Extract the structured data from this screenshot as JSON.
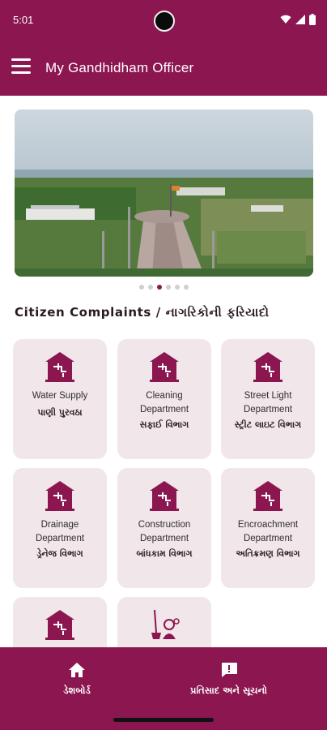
{
  "status_bar": {
    "time": "5:01",
    "icons": [
      "wifi-icon",
      "signal-icon",
      "battery-icon"
    ]
  },
  "app_bar": {
    "title": "My Gandhidham Officer",
    "menu_icon": "hamburger-menu-icon"
  },
  "carousel": {
    "dot_count": 6,
    "active_index": 2
  },
  "section": {
    "title": "Citizen Complaints / નાગરિકોની ફરિયાદો"
  },
  "departments": [
    {
      "en": "Water Supply",
      "gu": "પાણી પુરવઠા",
      "icon": "department-building-icon"
    },
    {
      "en": "Cleaning Department",
      "gu": "સફાઈ વિભાગ",
      "icon": "department-building-icon"
    },
    {
      "en": "Street Light Department",
      "gu": "સ્ટ્રીટ લાઇટ વિભાગ",
      "icon": "department-building-icon"
    },
    {
      "en": "Drainage Department",
      "gu": "ડ્રેનેજ વિભાગ",
      "icon": "department-building-icon"
    },
    {
      "en": "Construction Department",
      "gu": "બાંધકામ વિભાગ",
      "icon": "department-building-icon"
    },
    {
      "en": "Encroachment Department",
      "gu": "અતિક્રમણ વિભાગ",
      "icon": "department-building-icon"
    },
    {
      "en": "",
      "gu": "",
      "icon": "department-building-icon"
    },
    {
      "en": "",
      "gu": "",
      "icon": "sanitation-worker-icon"
    }
  ],
  "bottom_nav": {
    "dashboard": {
      "label": "ડેશબોર્ડ",
      "icon": "home-icon"
    },
    "feedback": {
      "label": "પ્રતિસાદ અને સૂચનો",
      "icon": "feedback-icon"
    }
  },
  "colors": {
    "primary": "#8c1650",
    "card_bg": "#f1e6ea",
    "text_dark": "#2a1a22"
  }
}
